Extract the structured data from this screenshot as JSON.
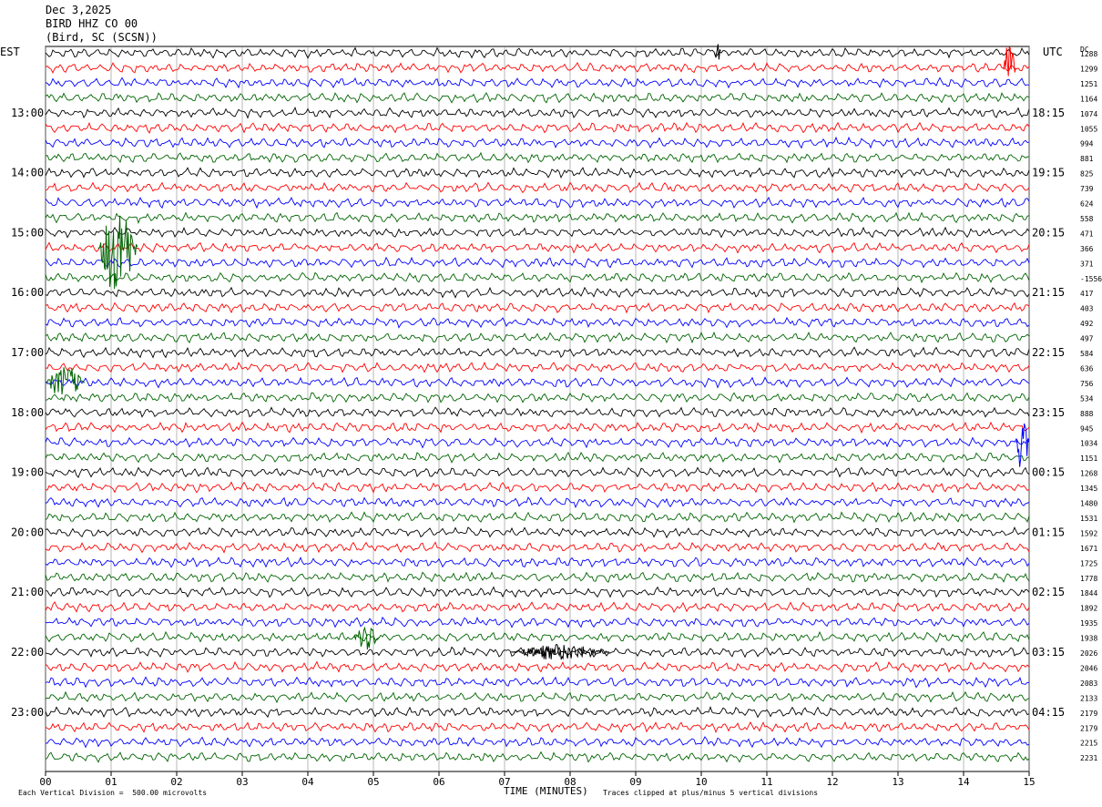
{
  "header": {
    "date": "Dec 3,2025",
    "station": "BIRD HHZ CO 00",
    "location": "(Bird, SC (SCSN))"
  },
  "left_corner_label": "EST",
  "right_corner_label": "UTC",
  "dc_label": "DC",
  "colors": [
    "#000000",
    "#ff0000",
    "#0000ff",
    "#006400"
  ],
  "chart_data": {
    "type": "line",
    "title": "",
    "xlabel": "TIME (MINUTES)",
    "xlim": [
      0,
      15
    ],
    "x_ticks": [
      "00",
      "01",
      "02",
      "03",
      "04",
      "05",
      "06",
      "07",
      "08",
      "09",
      "10",
      "11",
      "12",
      "13",
      "14",
      "15"
    ],
    "trace_count": 48,
    "left_hour_labels": [
      "13:00",
      "14:00",
      "15:00",
      "16:00",
      "17:00",
      "18:00",
      "19:00",
      "20:00",
      "21:00",
      "22:00",
      "23:00"
    ],
    "right_hour_labels": [
      "18:15",
      "19:15",
      "20:15",
      "21:15",
      "22:15",
      "23:15",
      "00:15",
      "01:15",
      "02:15",
      "03:15",
      "04:15"
    ],
    "dc_offsets": [
      "1288",
      "1299",
      "1251",
      "1164",
      "1074",
      "1055",
      "994",
      "881",
      "825",
      "739",
      "624",
      "558",
      "471",
      "366",
      "371",
      "-1556",
      "417",
      "403",
      "492",
      "497",
      "584",
      "636",
      "756",
      "534",
      "888",
      "945",
      "1034",
      "1151",
      "1268",
      "1345",
      "1480",
      "1531",
      "1592",
      "1671",
      "1725",
      "1778",
      "1844",
      "1892",
      "1935",
      "1938",
      "2026",
      "2046",
      "2083",
      "2133",
      "2179",
      "2179",
      "2215",
      "2231"
    ],
    "footer_left": "Each Vertical Division =  500.00 microvolts",
    "footer_right": "Traces clipped at plus/minus 5 vertical divisions"
  }
}
